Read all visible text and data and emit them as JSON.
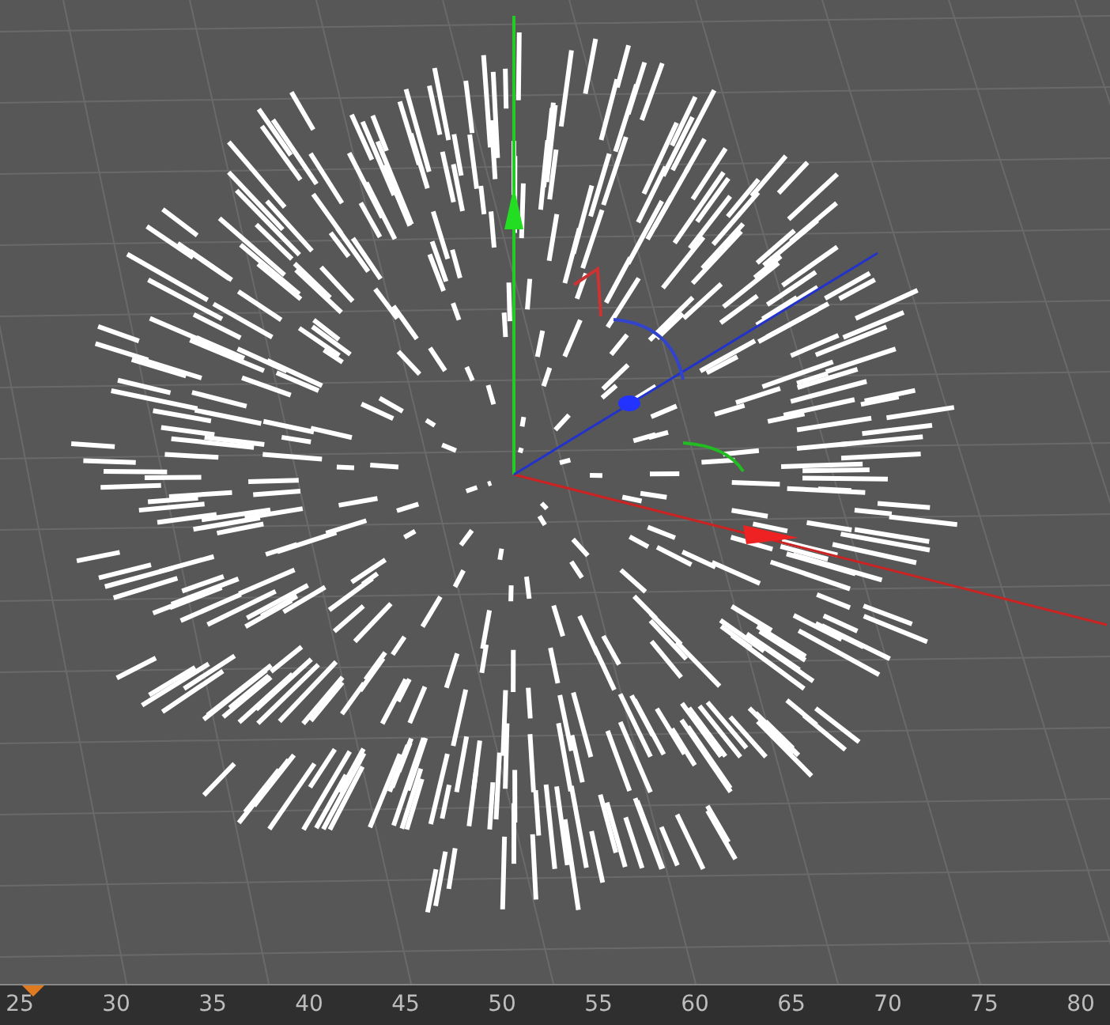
{
  "timeline": {
    "ticks": [
      "25",
      "30",
      "35",
      "40",
      "45",
      "50",
      "55",
      "60",
      "65",
      "70",
      "75",
      "80"
    ]
  }
}
